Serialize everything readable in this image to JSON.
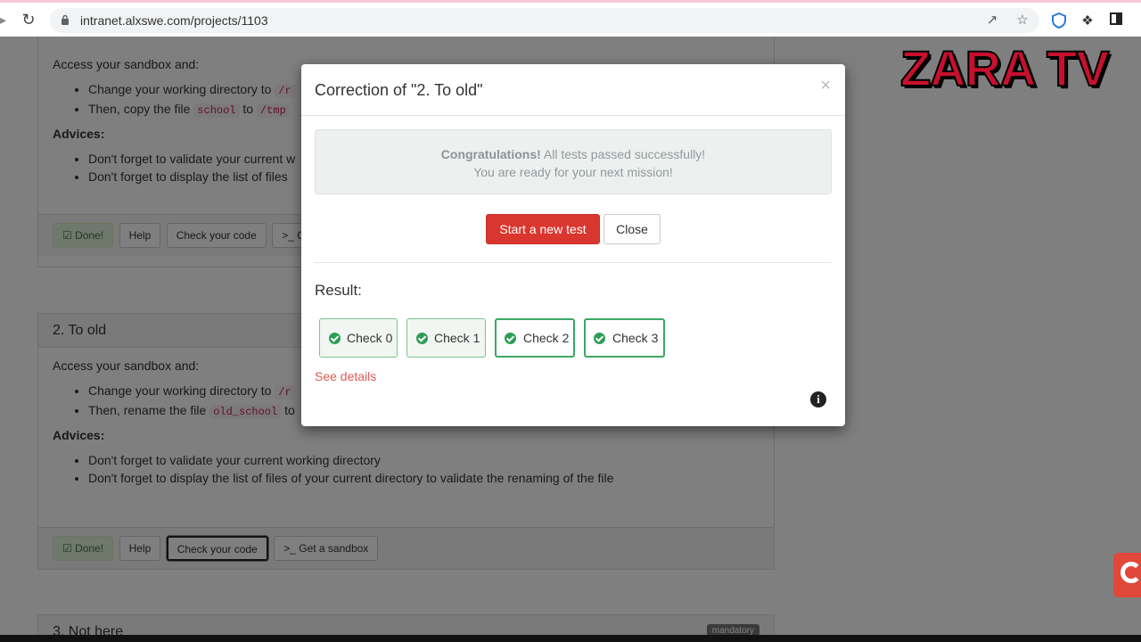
{
  "browser": {
    "url": "intranet.alxswe.com/projects/1103"
  },
  "page": {
    "task1": {
      "intro": "Access your sandbox and:",
      "item1_text": "Change your working directory to",
      "item1_code": "/r",
      "item2_pre": "Then, copy the file",
      "item2_code1": "school",
      "item2_mid": "to",
      "item2_code2": "/tmp",
      "advices_title": "Advices:",
      "advice1": "Don't forget to validate your current w",
      "advice2": "Don't forget to display the list of files",
      "buttons": {
        "done": "Done!",
        "help": "Help",
        "check": "Check your code",
        "sandbox": ">_ G"
      }
    },
    "task2": {
      "title": "2. To old",
      "intro": "Access your sandbox and:",
      "item1_text": "Change your working directory to",
      "item1_code": "/r",
      "item2_pre": "Then, rename the file",
      "item2_code1": "old_school",
      "item2_mid": "to",
      "advices_title": "Advices:",
      "advice1": "Don't forget to validate your current working directory",
      "advice2": "Don't forget to display the list of files of your current directory to validate the renaming of the file",
      "buttons": {
        "done": "Done!",
        "help": "Help",
        "check": "Check your code",
        "sandbox": ">_ Get a sandbox"
      }
    },
    "task3": {
      "title": "3. Not here",
      "badge": "mandatory"
    }
  },
  "watermark": "ZARA TV",
  "modal": {
    "title": "Correction of \"2. To old\"",
    "close_glyph": "×",
    "alert_strong": "Congratulations!",
    "alert_line1": " All tests passed successfully!",
    "alert_line2": "You are ready for your next mission!",
    "start_button": "Start a new test",
    "close_button": "Close",
    "result_title": "Result:",
    "checks": [
      "Check 0",
      "Check 1",
      "Check 2",
      "Check 3"
    ],
    "see_details": "See details",
    "info_glyph": "i"
  },
  "colors": {
    "danger": "#d9362f",
    "success": "#2e9e55",
    "link": "#e05a55"
  }
}
